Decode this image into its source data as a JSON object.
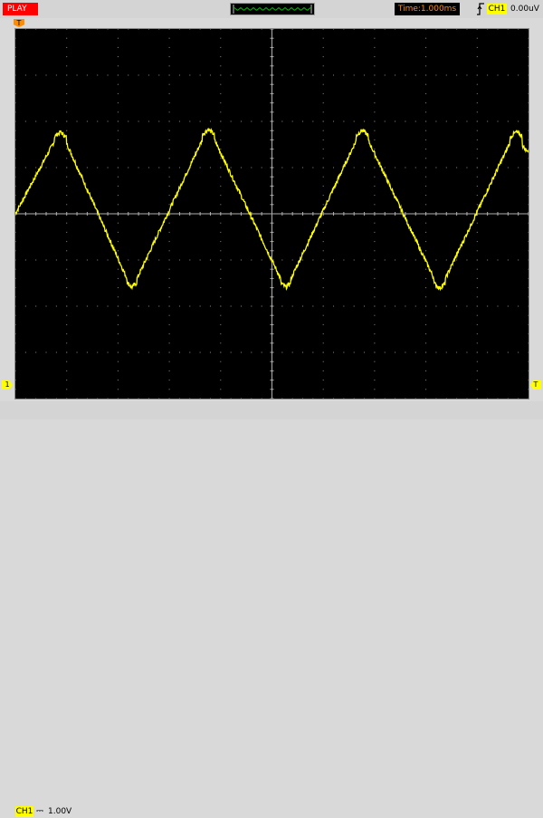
{
  "toolbar": {
    "run_state": "PLAY",
    "timebase": "Time:1.000ms",
    "trigger": {
      "edge_icon": "rising-edge-icon",
      "channel": "CH1",
      "level": "0.00uV"
    }
  },
  "markers": {
    "trigger_position": "T",
    "channel_ground": "1",
    "trigger_level": "T"
  },
  "channel": {
    "name": "CH1",
    "coupling": "⎓",
    "scale": "1.00V"
  },
  "colors": {
    "trace": "#ffff00",
    "grid": "#8c8c8c",
    "screen": "#000000",
    "play": "#ff0000",
    "timebase_text": "#ff8c00",
    "overview_wave": "#00c000"
  },
  "chart_data": {
    "type": "line",
    "title": "",
    "xlabel": "",
    "ylabel": "",
    "xlim": [
      0,
      10
    ],
    "ylim": [
      -4,
      4
    ],
    "grid": true,
    "series": [
      {
        "x": [
          0,
          0.88,
          2.27,
          3.76,
          5.27,
          6.76,
          8.27,
          9.76,
          10.0
        ],
        "y": [
          0,
          1.82,
          -1.64,
          1.88,
          -1.64,
          1.86,
          -1.66,
          1.82,
          1.34
        ]
      }
    ]
  }
}
